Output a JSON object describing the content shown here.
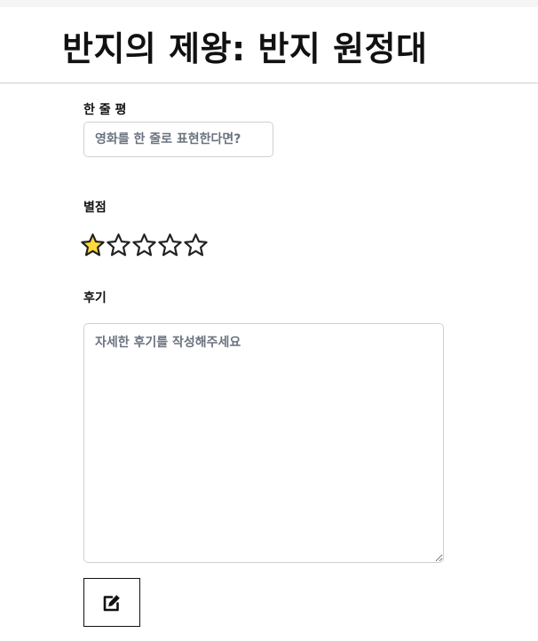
{
  "header": {
    "title": "반지의 제왕: 반지 원정대"
  },
  "form": {
    "oneline": {
      "label": "한 줄 평",
      "placeholder": "영화를 한 줄로 표현한다면?",
      "value": ""
    },
    "rating": {
      "label": "별점",
      "value": 1,
      "max": 5,
      "filled_color": "#FFD93B",
      "empty_color": "#FFFFFF",
      "outline_color": "#222222"
    },
    "review": {
      "label": "후기",
      "placeholder": "자세한 후기를 작성해주세요",
      "value": ""
    },
    "submit": {
      "icon": "edit-icon"
    }
  }
}
